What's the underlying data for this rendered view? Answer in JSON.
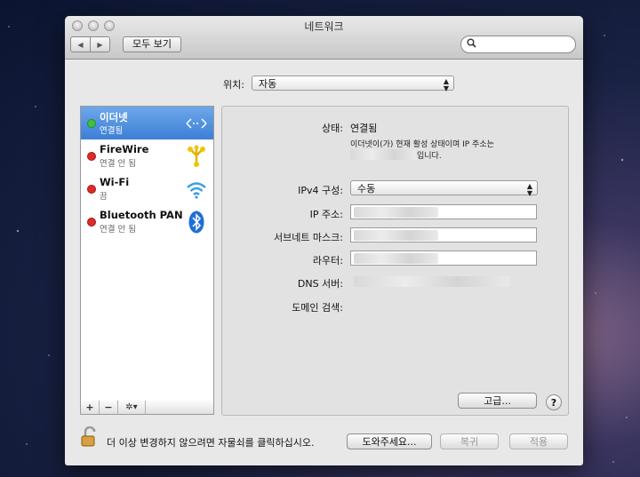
{
  "window": {
    "title": "네트워크",
    "nav": {
      "back_icon": "chevron-left-icon",
      "forward_icon": "chevron-right-icon"
    },
    "show_all_label": "모두 보기",
    "search": {
      "placeholder": "",
      "icon": "search-icon"
    }
  },
  "location": {
    "label": "위치:",
    "value": "자동"
  },
  "services": [
    {
      "name": "이더넷",
      "status": "연결됨",
      "status_color": "#3fc23f",
      "icon": "ethernet-icon",
      "selected": true
    },
    {
      "name": "FireWire",
      "status": "연결 안 됨",
      "status_color": "#e02a2a",
      "icon": "firewire-icon",
      "selected": false
    },
    {
      "name": "Wi-Fi",
      "status": "끔",
      "status_color": "#e02a2a",
      "icon": "wifi-icon",
      "selected": false
    },
    {
      "name": "Bluetooth PAN",
      "status": "연결 안 됨",
      "status_color": "#e02a2a",
      "icon": "bluetooth-icon",
      "selected": false
    }
  ],
  "list_toolbar": {
    "add": "+",
    "remove": "−",
    "gear": "✲▾"
  },
  "detail": {
    "status_label": "상태:",
    "status_value": "연결됨",
    "status_desc_1": "이더넷이(가) 현재 활성 상태이며 IP 주소는",
    "status_desc_2": "입니다.",
    "ipv4_label": "IPv4 구성:",
    "ipv4_value": "수동",
    "ip_label": "IP 주소:",
    "subnet_label": "서브네트 마스크:",
    "router_label": "라우터:",
    "dns_label": "DNS 서버:",
    "domain_label": "도메인 검색:",
    "advanced_label": "고급...",
    "help_label": "?"
  },
  "footer": {
    "lock_text": "더 이상 변경하지 않으려면 자물쇠를 클릭하십시오.",
    "assist_label": "도와주세요...",
    "revert_label": "복귀",
    "apply_label": "적용"
  },
  "colors": {
    "selection": "#3d7fd6",
    "connected": "#3fc23f",
    "disconnected": "#e02a2a"
  }
}
